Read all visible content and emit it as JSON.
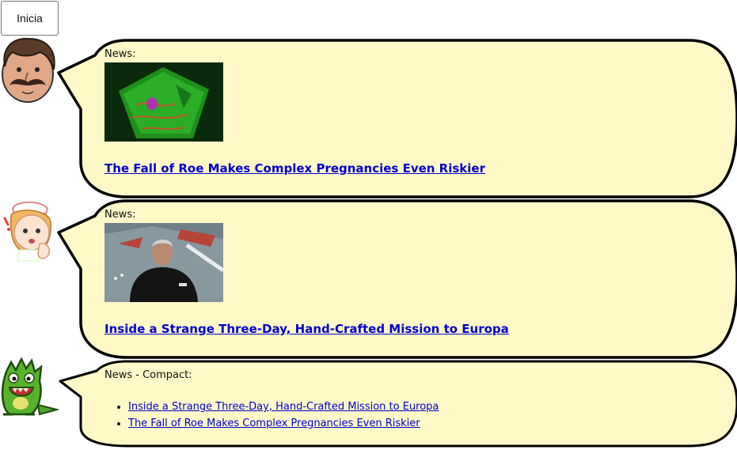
{
  "start_button": {
    "label": "Inicia"
  },
  "messages": [
    {
      "kicker": "News:",
      "link": "The Fall of Roe Makes Complex Pregnancies Even Riskier"
    },
    {
      "kicker": "News:",
      "link": "Inside a Strange Three-Day, Hand-Crafted Mission to Europa"
    },
    {
      "kicker": "News - Compact:",
      "items": [
        "Inside a Strange Three-Day, Hand-Crafted Mission to Europa",
        "The Fall of Roe Makes Complex Pregnancies Even Riskier"
      ]
    }
  ],
  "colors": {
    "bubble_fill": "#fff9c8",
    "bubble_stroke": "#000000",
    "link": "#0000cc"
  },
  "icons": [
    "man-mustache-avatar",
    "nurse-avatar",
    "green-monster-avatar"
  ]
}
